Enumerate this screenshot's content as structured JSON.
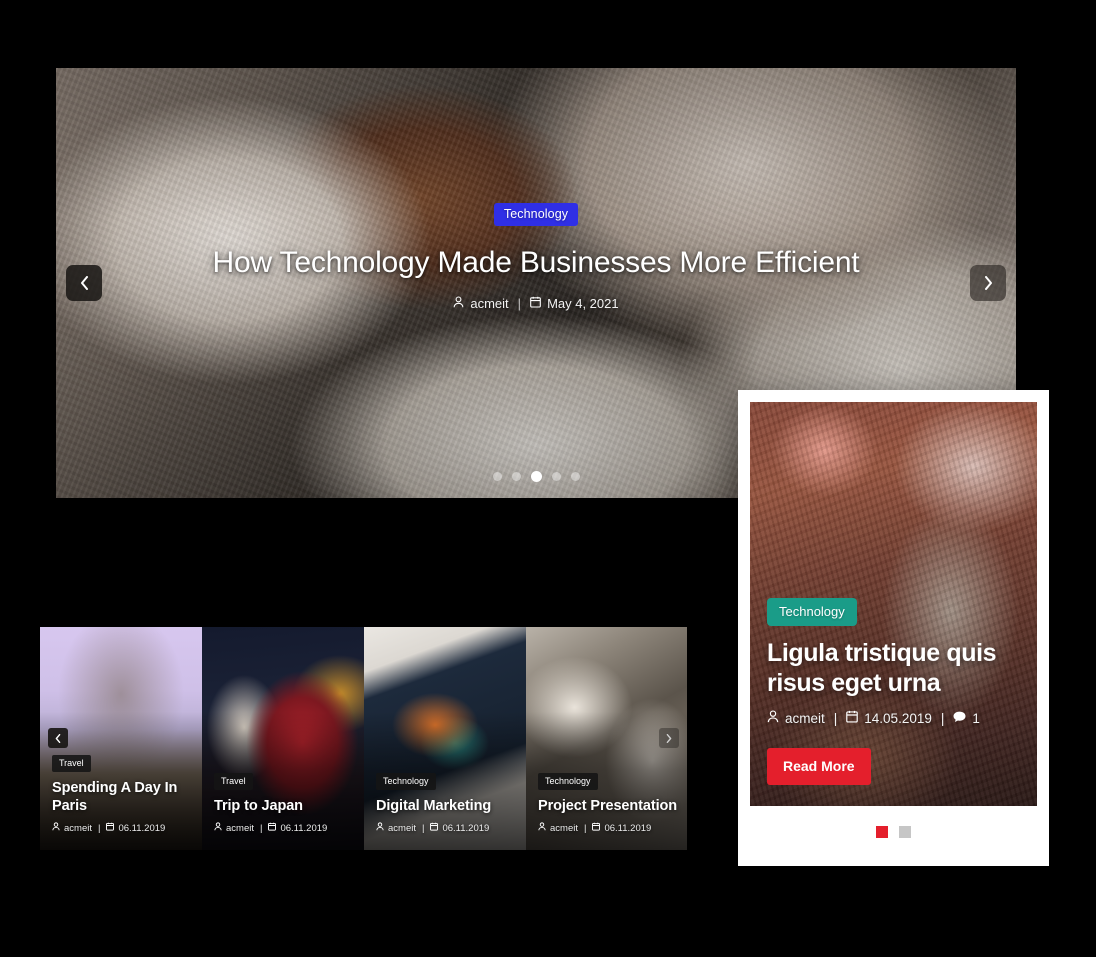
{
  "hero": {
    "category": "Technology",
    "title": "How Technology Made Businesses More Efficient",
    "author": "acmeit",
    "date": "May 4, 2021",
    "separator": "|",
    "prev_label": "‹",
    "next_label": "›",
    "dots": [
      {
        "active": false
      },
      {
        "active": false
      },
      {
        "active": true
      },
      {
        "active": false
      },
      {
        "active": false
      }
    ],
    "accent_color": "#2f2fe6"
  },
  "strip": {
    "prev_label": "‹",
    "next_label": "›",
    "cards": [
      {
        "category": "Travel",
        "title": "Spending A Day In Paris",
        "author": "acmeit",
        "date": "06.11.2019",
        "separator": "|"
      },
      {
        "category": "Travel",
        "title": "Trip to Japan",
        "author": "acmeit",
        "date": "06.11.2019",
        "separator": "|"
      },
      {
        "category": "Technology",
        "title": "Digital Marketing",
        "author": "acmeit",
        "date": "06.11.2019",
        "separator": "|"
      },
      {
        "category": "Technology",
        "title": "Project Presentation",
        "author": "acmeit",
        "date": "06.11.2019",
        "separator": "|"
      }
    ]
  },
  "feature_card": {
    "category": "Technology",
    "title": "Ligula tristique quis risus eget urna",
    "author": "acmeit",
    "date": "14.05.2019",
    "comments": "1",
    "separator": "|",
    "read_more": "Read More",
    "badge_color": "#1a9c88",
    "button_color": "#e41f2c",
    "dots": [
      {
        "active": true
      },
      {
        "active": false
      }
    ]
  }
}
